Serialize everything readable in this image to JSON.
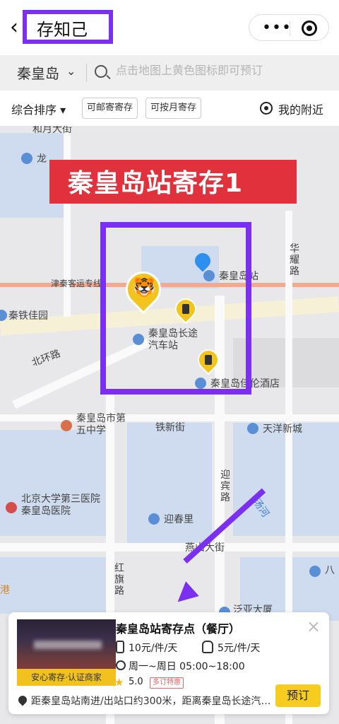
{
  "nav": {
    "title": "存知己",
    "back_icon": "chevron-left-icon",
    "more_icon": "more-dots-icon",
    "target_icon": "target-icon"
  },
  "search": {
    "city": "秦皇岛",
    "placeholder": "点击地图上黄色图标即可预订"
  },
  "filters": {
    "sort_label": "综合排序 ▾",
    "chips": [
      "可邮寄寄存",
      "可按月寄存"
    ],
    "nearby_label": "我的附近"
  },
  "map": {
    "banner": "秦皇岛站寄存1",
    "labels": {
      "heyue": "和月大街",
      "long": "龙",
      "jinqin": "津秦客运专线",
      "qinhuangdao_station": "秦皇岛站",
      "huayao": "华耀路",
      "qintie": "秦铁佳园",
      "bus_station": "秦皇岛长途汽车站",
      "beihuan": "北环路",
      "hotel": "秦皇岛佳伦酒店",
      "school": "秦皇岛市第五中学",
      "tiexin": "铁新街",
      "tianyang": "天洋新城",
      "hospital": "北京大学第三医院秦皇岛医院",
      "yingbin": "迎宾路",
      "yingchun": "迎春里",
      "tanghe": "汤河",
      "yanshan": "燕山大街",
      "hongqi": "红旗路",
      "ba": "八",
      "gang": "港",
      "huawei": "泛亚大厦"
    }
  },
  "card": {
    "title": "秦皇岛站寄存点（餐厅）",
    "badge": "安心寄存·认证商家",
    "price_large": "10元/件/天",
    "price_small": "5元/件/天",
    "hours": "周一~周日 05:00~18:00",
    "rating": "5.0",
    "discount": "多订特惠",
    "distance": "距秦皇岛站南进/出站口约300米，距离秦皇岛长途汽车站约100米",
    "book_label": "预订",
    "close_icon": "close-icon"
  },
  "colors": {
    "accent_purple": "#7b2ff0",
    "banner_red": "#e0313d",
    "pin_yellow": "#f3c31e",
    "button_yellow": "#f6cc1e"
  }
}
